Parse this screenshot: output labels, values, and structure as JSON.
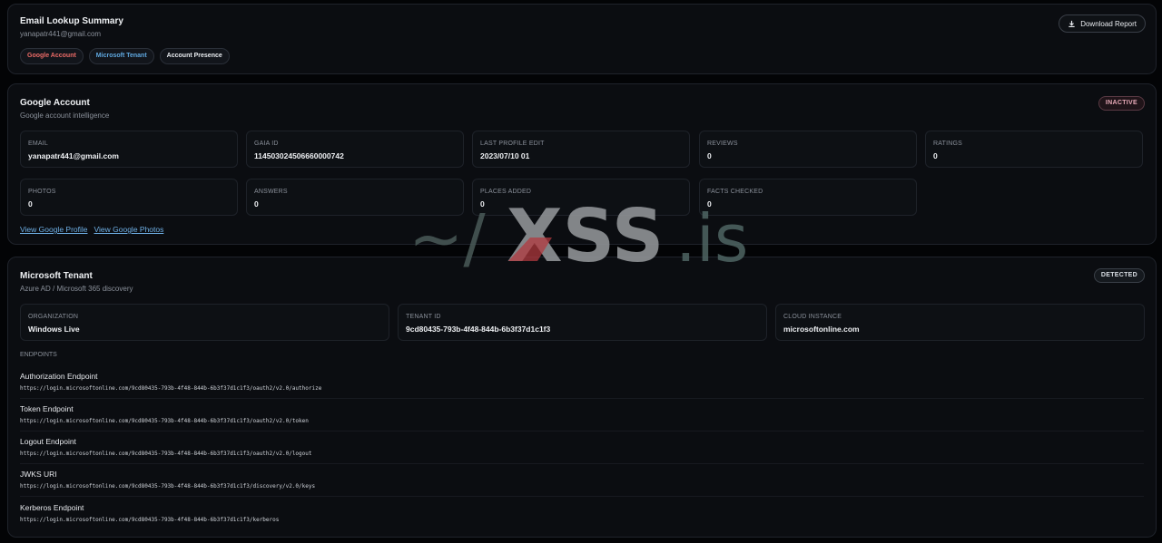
{
  "summary": {
    "title": "Email Lookup Summary",
    "email": "yanapatr441@gmail.com",
    "pills": [
      "Google Account",
      "Microsoft Tenant",
      "Account Presence"
    ],
    "download_label": "Download Report"
  },
  "google": {
    "title": "Google Account",
    "subtitle": "Google account intelligence",
    "status": "INACTIVE",
    "stats": [
      {
        "label": "EMAIL",
        "value": "yanapatr441@gmail.com"
      },
      {
        "label": "GAIA ID",
        "value": "114503024506660000742"
      },
      {
        "label": "LAST PROFILE EDIT",
        "value": "2023/07/10 01"
      },
      {
        "label": "REVIEWS",
        "value": "0"
      },
      {
        "label": "RATINGS",
        "value": "0"
      },
      {
        "label": "PHOTOS",
        "value": "0"
      },
      {
        "label": "ANSWERS",
        "value": "0"
      },
      {
        "label": "PLACES ADDED",
        "value": "0"
      },
      {
        "label": "FACTS CHECKED",
        "value": "0"
      }
    ],
    "links": [
      "View Google Profile",
      "View Google Photos"
    ]
  },
  "microsoft": {
    "title": "Microsoft Tenant",
    "subtitle": "Azure AD / Microsoft 365 discovery",
    "status": "DETECTED",
    "stats": [
      {
        "label": "ORGANIZATION",
        "value": "Windows Live"
      },
      {
        "label": "TENANT ID",
        "value": "9cd80435-793b-4f48-844b-6b3f37d1c1f3"
      },
      {
        "label": "CLOUD INSTANCE",
        "value": "microsoftonline.com"
      }
    ],
    "endpoints_title": "ENDPOINTS",
    "endpoints": [
      {
        "name": "Authorization Endpoint",
        "url": "https://login.microsoftonline.com/9cd80435-793b-4f48-844b-6b3f37d1c1f3/oauth2/v2.0/authorize"
      },
      {
        "name": "Token Endpoint",
        "url": "https://login.microsoftonline.com/9cd80435-793b-4f48-844b-6b3f37d1c1f3/oauth2/v2.0/token"
      },
      {
        "name": "Logout Endpoint",
        "url": "https://login.microsoftonline.com/9cd80435-793b-4f48-844b-6b3f37d1c1f3/oauth2/v2.0/logout"
      },
      {
        "name": "JWKS URI",
        "url": "https://login.microsoftonline.com/9cd80435-793b-4f48-844b-6b3f37d1c1f3/discovery/v2.0/keys"
      },
      {
        "name": "Kerberos Endpoint",
        "url": "https://login.microsoftonline.com/9cd80435-793b-4f48-844b-6b3f37d1c1f3/kerberos"
      }
    ]
  },
  "watermark": {
    "prefix": "~/",
    "brand": "XSS",
    "suffix": ".is"
  },
  "colors": {
    "accent_red": "#ec6b67",
    "accent_blue": "#5fa8e0",
    "link": "#6fb0e6",
    "background": "#030406"
  }
}
